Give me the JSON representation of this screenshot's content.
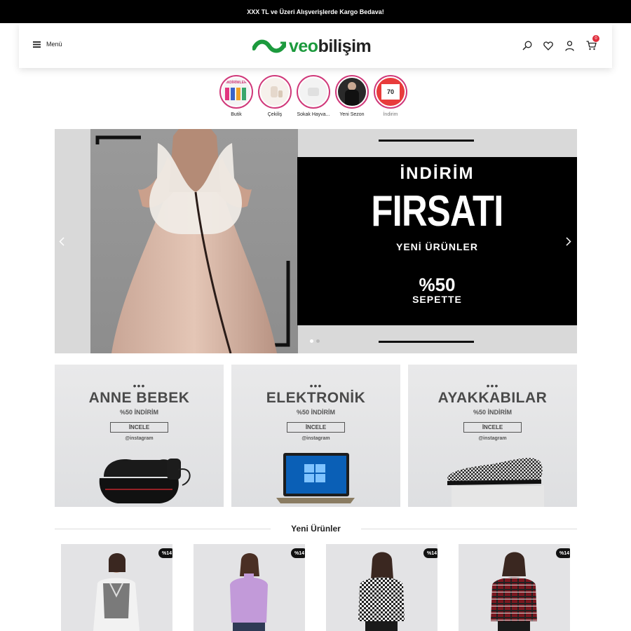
{
  "topbar": {
    "text": "XXX TL ve Üzeri Alışverişlerde Kargo Bedava!"
  },
  "header": {
    "menu_label": "Menü",
    "logo_part1": "veo",
    "logo_part2": "bilişim",
    "cart_count": "0",
    "icons": [
      "search-icon",
      "heart-icon",
      "user-icon",
      "cart-icon"
    ]
  },
  "stories": [
    {
      "label": "Butik",
      "thumb_text": "İNDİRİMLER"
    },
    {
      "label": "Çekiliş"
    },
    {
      "label": "Sokak Hayva..."
    },
    {
      "label": "Yeni Sezon"
    },
    {
      "label": "İndirim",
      "thumb_text": "70"
    }
  ],
  "hero": {
    "line1": "İNDİRİM",
    "line2": "FIRSATI",
    "line3": "YENİ ÜRÜNLER",
    "line4": "%50",
    "line5": "SEPETTE",
    "slide_count": 2,
    "active_slide": 1
  },
  "categories": [
    {
      "title": "ANNE BEBEK",
      "subtitle": "%50 İNDİRİM",
      "button": "İNCELE",
      "handle": "@instagram"
    },
    {
      "title": "ELEKTRONİK",
      "subtitle": "%50 İNDİRİM",
      "button": "İNCELE",
      "handle": "@instagram"
    },
    {
      "title": "AYAKKABILAR",
      "subtitle": "%50 İNDİRİM",
      "button": "İNCELE",
      "handle": "@instagram"
    }
  ],
  "section": {
    "title": "Yeni Ürünler"
  },
  "products": [
    {
      "badge": "%14"
    },
    {
      "badge": "%14"
    },
    {
      "badge": "%14"
    },
    {
      "badge": "%14"
    }
  ],
  "colors": {
    "brand_green": "#1c9a3d",
    "story_ring": "#d0397a",
    "badge_red": "#e02d3c"
  }
}
